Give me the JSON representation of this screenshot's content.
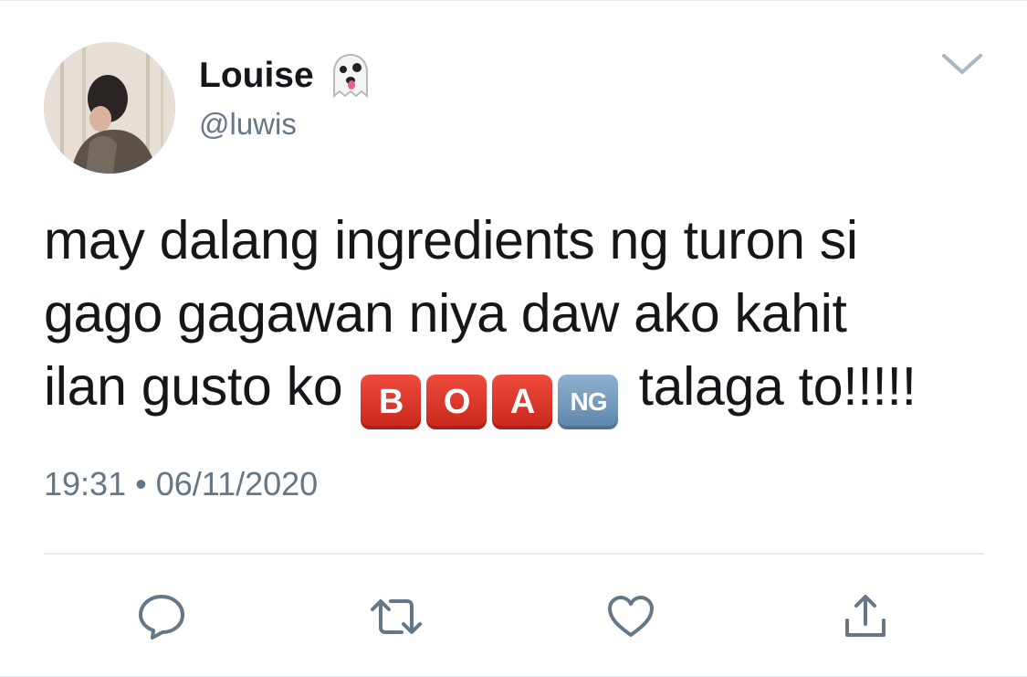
{
  "tweet": {
    "display_name": "Louise",
    "name_emoji": "👻",
    "handle": "@luwis",
    "text_lines": [
      "may dalang ingredients ng turon si",
      "gago gagawan niya daw ako kahit"
    ],
    "line3_prefix": "ilan gusto ko",
    "emoji_letters": [
      "B",
      "O",
      "A",
      "NG"
    ],
    "line3_suffix": "talaga to!!!!!",
    "time": "19:31",
    "separator": "•",
    "date": "06/11/2020"
  },
  "icons": {
    "menu": "chevron-down-icon",
    "reply": "reply-icon",
    "retweet": "retweet-icon",
    "like": "heart-icon",
    "share": "share-icon"
  },
  "colors": {
    "text": "#14171a",
    "secondary": "#657786",
    "icon": "#657786",
    "divider": "#e6ecf0",
    "emoji_red": "#d9342a",
    "emoji_blue": "#6f94b8"
  }
}
